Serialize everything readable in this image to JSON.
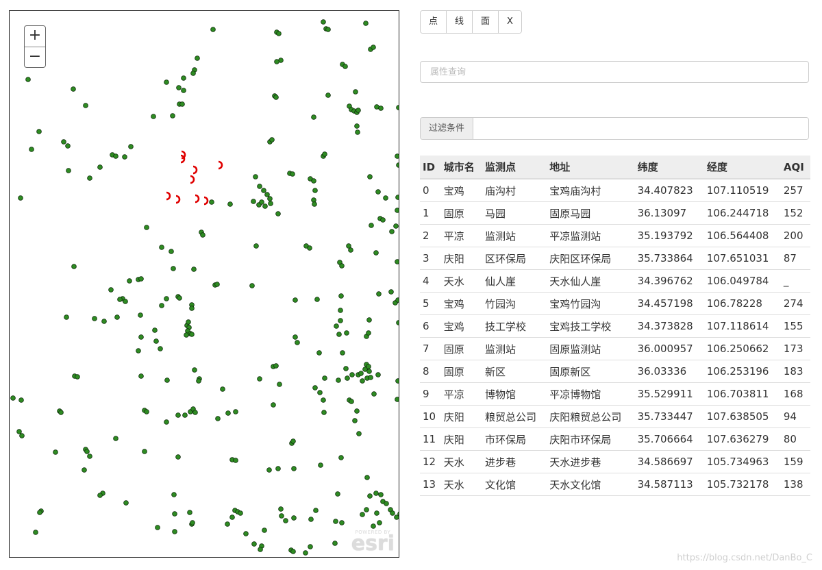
{
  "map": {
    "zoom_in_label": "+",
    "zoom_out_label": "−",
    "attribution_powered": "POWERED BY",
    "attribution_logo": "esri",
    "marker_colors": {
      "station": "#2e8b22",
      "station_stroke": "#0d2b0a",
      "highlight": "#e00000"
    }
  },
  "toolbar": {
    "point_label": "点",
    "line_label": "线",
    "polygon_label": "面",
    "clear_label": "X"
  },
  "search": {
    "placeholder": "属性查询",
    "value": ""
  },
  "filter": {
    "addon_label": "过滤条件",
    "value": ""
  },
  "table": {
    "headers": [
      "ID",
      "城市名",
      "监测点",
      "地址",
      "纬度",
      "经度",
      "AQI"
    ],
    "rows": [
      [
        "0",
        "宝鸡",
        "庙沟村",
        "宝鸡庙沟村",
        "34.407823",
        "107.110519",
        "257"
      ],
      [
        "1",
        "固原",
        "马园",
        "固原马园",
        "36.13097",
        "106.244718",
        "152"
      ],
      [
        "2",
        "平凉",
        "监测站",
        "平凉监测站",
        "35.193792",
        "106.564408",
        "200"
      ],
      [
        "3",
        "庆阳",
        "区环保局",
        "庆阳区环保局",
        "35.733864",
        "107.651031",
        "87"
      ],
      [
        "4",
        "天水",
        "仙人崖",
        "天水仙人崖",
        "34.396762",
        "106.049784",
        "_"
      ],
      [
        "5",
        "宝鸡",
        "竹园沟",
        "宝鸡竹园沟",
        "34.457198",
        "106.78228",
        "274"
      ],
      [
        "6",
        "宝鸡",
        "技工学校",
        "宝鸡技工学校",
        "34.373828",
        "107.118614",
        "155"
      ],
      [
        "7",
        "固原",
        "监测站",
        "固原监测站",
        "36.000957",
        "106.250662",
        "173"
      ],
      [
        "8",
        "固原",
        "新区",
        "固原新区",
        "36.03336",
        "106.253196",
        "183"
      ],
      [
        "9",
        "平凉",
        "博物馆",
        "平凉博物馆",
        "35.529911",
        "106.703811",
        "168"
      ],
      [
        "10",
        "庆阳",
        "粮贸总公司",
        "庆阳粮贸总公司",
        "35.733447",
        "107.638505",
        "94"
      ],
      [
        "11",
        "庆阳",
        "市环保局",
        "庆阳市环保局",
        "35.706664",
        "107.636279",
        "80"
      ],
      [
        "12",
        "天水",
        "进步巷",
        "天水进步巷",
        "34.586697",
        "105.734963",
        "159"
      ],
      [
        "13",
        "天水",
        "文化馆",
        "天水文化馆",
        "34.587113",
        "105.732178",
        "138"
      ]
    ]
  },
  "watermark": "https://blog.csdn.net/DanBo_C"
}
